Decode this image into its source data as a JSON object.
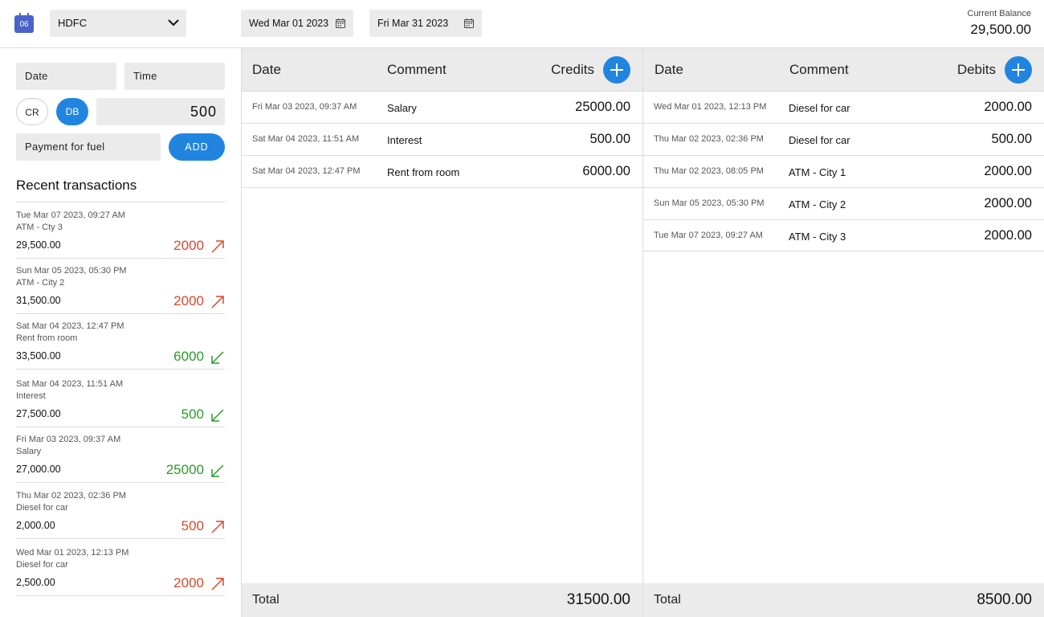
{
  "header": {
    "app_icon_text": "06",
    "bank": "HDFC",
    "start_date": "Wed Mar 01 2023",
    "end_date": "Fri Mar 31 2023",
    "balance_label": "Current Balance",
    "balance_value": "29,500.00"
  },
  "form": {
    "date_placeholder": "Date",
    "time_placeholder": "Time",
    "cr_label": "CR",
    "db_label": "DB",
    "amount": "500",
    "comment": "Payment for fuel",
    "add_label": "ADD",
    "selected_type": "DB"
  },
  "recent": {
    "title": "Recent transactions",
    "items": [
      {
        "date": "Tue Mar 07 2023, 09:27 AM",
        "comment": "ATM - Cty 3",
        "balance": "29,500.00",
        "amount": "2000",
        "type": "debit"
      },
      {
        "date": "Sun Mar 05 2023, 05:30 PM",
        "comment": "ATM - City 2",
        "balance": "31,500.00",
        "amount": "2000",
        "type": "debit"
      },
      {
        "date": "Sat Mar 04 2023, 12:47 PM",
        "comment": "Rent from room",
        "balance": "33,500.00",
        "amount": "6000",
        "type": "credit"
      },
      {
        "date": "Sat Mar 04 2023, 11:51 AM",
        "comment": "Interest",
        "balance": "27,500.00",
        "amount": "500",
        "type": "credit"
      },
      {
        "date": "Fri Mar 03 2023, 09:37 AM",
        "comment": "Salary",
        "balance": "27,000.00",
        "amount": "25000",
        "type": "credit"
      },
      {
        "date": "Thu Mar 02 2023, 02:36 PM",
        "comment": "Diesel for car",
        "balance": "2,000.00",
        "amount": "500",
        "type": "debit"
      },
      {
        "date": "Wed Mar 01 2023, 12:13 PM",
        "comment": "Diesel for car",
        "balance": "2,500.00",
        "amount": "2000",
        "type": "debit"
      }
    ]
  },
  "credits": {
    "col_date": "Date",
    "col_comment": "Comment",
    "title": "Credits",
    "rows": [
      {
        "date": "Fri Mar 03 2023, 09:37 AM",
        "comment": "Salary",
        "amount": "25000.00"
      },
      {
        "date": "Sat Mar 04 2023, 11:51 AM",
        "comment": "Interest",
        "amount": "500.00"
      },
      {
        "date": "Sat Mar 04 2023, 12:47 PM",
        "comment": "Rent from room",
        "amount": "6000.00"
      }
    ],
    "total_label": "Total",
    "total": "31500.00"
  },
  "debits": {
    "col_date": "Date",
    "col_comment": "Comment",
    "title": "Debits",
    "rows": [
      {
        "date": "Wed Mar 01 2023, 12:13 PM",
        "comment": "Diesel for car",
        "amount": "2000.00"
      },
      {
        "date": "Thu Mar 02 2023, 02:36 PM",
        "comment": "Diesel for car",
        "amount": "500.00"
      },
      {
        "date": "Thu Mar 02 2023, 08:05 PM",
        "comment": "ATM - City 1",
        "amount": "2000.00"
      },
      {
        "date": "Sun Mar 05 2023, 05:30 PM",
        "comment": "ATM - City 2",
        "amount": "2000.00"
      },
      {
        "date": "Tue Mar 07 2023, 09:27 AM",
        "comment": "ATM - City 3",
        "amount": "2000.00"
      }
    ],
    "total_label": "Total",
    "total": "8500.00"
  },
  "colors": {
    "accent": "#2185e0",
    "debit": "#d9482b",
    "credit": "#2e9a2a"
  }
}
